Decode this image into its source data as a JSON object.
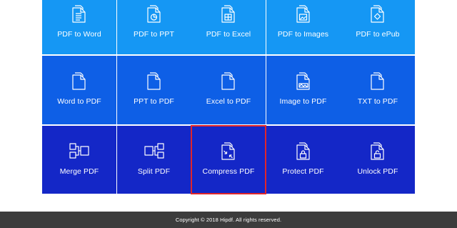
{
  "tools": {
    "pdf_to_word": "PDF to Word",
    "pdf_to_ppt": "PDF to PPT",
    "pdf_to_excel": "PDF to Excel",
    "pdf_to_images": "PDF to Images",
    "pdf_to_epub": "PDF to ePub",
    "word_to_pdf": "Word to PDF",
    "ppt_to_pdf": "PPT to PDF",
    "excel_to_pdf": "Excel to PDF",
    "image_to_pdf": "Image to PDF",
    "txt_to_pdf": "TXT to PDF",
    "merge_pdf": "Merge PDF",
    "split_pdf": "Split PDF",
    "compress_pdf": "Compress PDF",
    "protect_pdf": "Protect PDF",
    "unlock_pdf": "Unlock PDF"
  },
  "footer": {
    "copyright": "Copyright © 2018 Hipdf. All rights reserved."
  },
  "colors": {
    "row1": "#1597f4",
    "row2": "#0e5fe6",
    "row3": "#1427c7",
    "highlight": "#e0252b",
    "footer_bg": "#3c3c3c"
  }
}
